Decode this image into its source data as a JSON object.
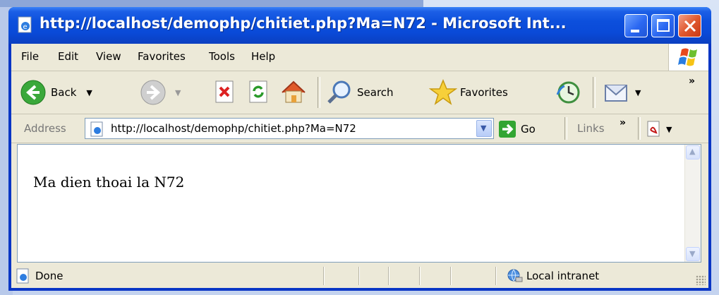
{
  "window": {
    "title": "http://localhost/demophp/chitiet.php?Ma=N72 - Microsoft Int..."
  },
  "menu": {
    "items": [
      "File",
      "Edit",
      "View",
      "Favorites",
      "Tools",
      "Help"
    ]
  },
  "toolbar": {
    "back_label": "Back",
    "search_label": "Search",
    "favorites_label": "Favorites"
  },
  "address": {
    "label": "Address",
    "value": "http://localhost/demophp/chitiet.php?Ma=N72",
    "go_label": "Go",
    "links_label": "Links"
  },
  "page": {
    "text": "Ma dien thoai la N72"
  },
  "status": {
    "text": "Done",
    "zone": "Local intranet"
  },
  "colors": {
    "titlebar": "#0a4ad8",
    "chrome": "#ece9d8",
    "close_button": "#e0592f"
  }
}
